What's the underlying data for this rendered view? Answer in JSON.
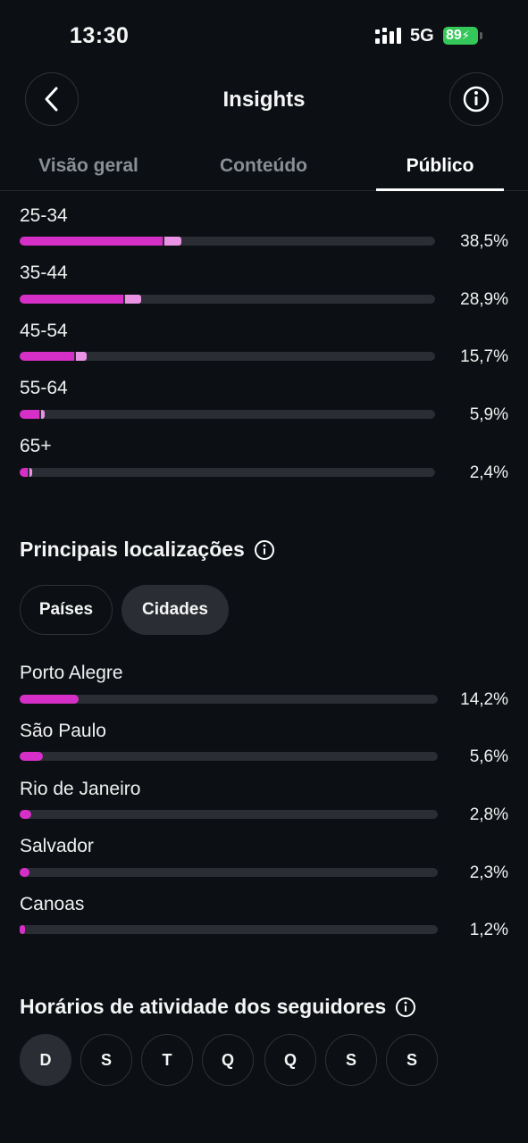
{
  "status_bar": {
    "time": "13:30",
    "network": "5G",
    "battery": "89"
  },
  "header": {
    "title": "Insights"
  },
  "tabs": [
    {
      "label": "Visão geral"
    },
    {
      "label": "Conteúdo"
    },
    {
      "label": "Público",
      "active": true
    }
  ],
  "age_ranges": [
    {
      "label": "25-34",
      "value": "38,5%",
      "pct": 38.5
    },
    {
      "label": "35-44",
      "value": "28,9%",
      "pct": 28.9
    },
    {
      "label": "45-54",
      "value": "15,7%",
      "pct": 15.7
    },
    {
      "label": "55-64",
      "value": "5,9%",
      "pct": 5.9
    },
    {
      "label": "65+",
      "value": "2,4%",
      "pct": 2.4
    }
  ],
  "locations": {
    "title": "Principais localizações",
    "filters": [
      {
        "label": "Países",
        "selected": false
      },
      {
        "label": "Cidades",
        "selected": true
      }
    ],
    "items": [
      {
        "label": "Porto Alegre",
        "value": "14,2%",
        "pct": 14.2
      },
      {
        "label": "São Paulo",
        "value": "5,6%",
        "pct": 5.6
      },
      {
        "label": "Rio de Janeiro",
        "value": "2,8%",
        "pct": 2.8
      },
      {
        "label": "Salvador",
        "value": "2,3%",
        "pct": 2.3
      },
      {
        "label": "Canoas",
        "value": "1,2%",
        "pct": 1.2
      }
    ]
  },
  "activity": {
    "title": "Horários de atividade dos seguidores",
    "days": [
      "D",
      "S",
      "T",
      "Q",
      "Q",
      "S",
      "S"
    ],
    "selected_day_index": 0
  },
  "colors": {
    "bar_primary": "#d62fc7",
    "bar_secondary": "#ea92e3",
    "track": "#2a2d33",
    "battery": "#34c759"
  }
}
